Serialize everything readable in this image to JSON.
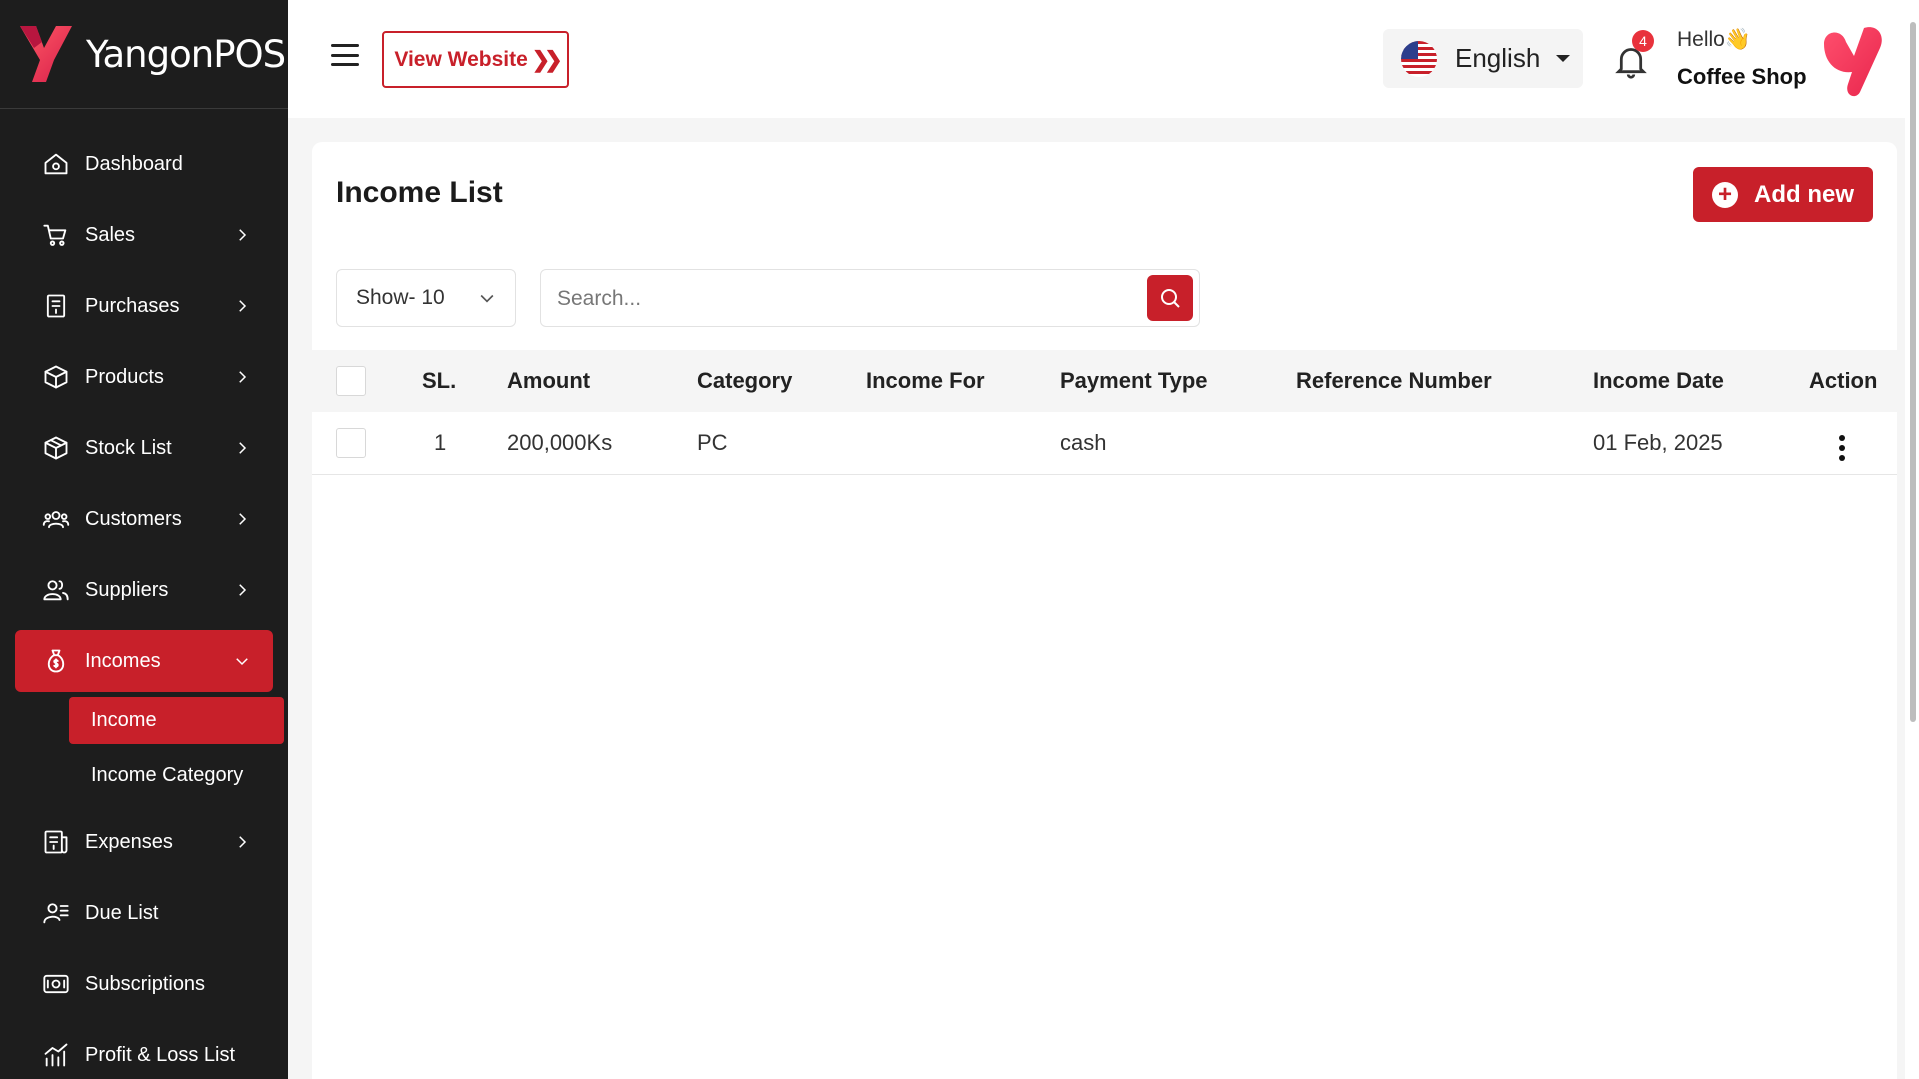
{
  "brand": {
    "name": "YangonPOS"
  },
  "sidebar": {
    "items": [
      {
        "label": "Dashboard",
        "icon": "home-icon",
        "has_children": false
      },
      {
        "label": "Sales",
        "icon": "cart-icon",
        "has_children": true
      },
      {
        "label": "Purchases",
        "icon": "receipt-icon",
        "has_children": true
      },
      {
        "label": "Products",
        "icon": "box-icon",
        "has_children": true
      },
      {
        "label": "Stock List",
        "icon": "package-icon",
        "has_children": true
      },
      {
        "label": "Customers",
        "icon": "users-icon",
        "has_children": true
      },
      {
        "label": "Suppliers",
        "icon": "user-group-icon",
        "has_children": true
      },
      {
        "label": "Incomes",
        "icon": "money-bag-icon",
        "has_children": true,
        "active": true
      },
      {
        "label": "Expenses",
        "icon": "invoice-icon",
        "has_children": true
      },
      {
        "label": "Due List",
        "icon": "user-list-icon",
        "has_children": false
      },
      {
        "label": "Subscriptions",
        "icon": "subscription-icon",
        "has_children": false
      },
      {
        "label": "Profit & Loss List",
        "icon": "chart-icon",
        "has_children": false
      }
    ],
    "incomes_sub": [
      {
        "label": "Income",
        "active": true
      },
      {
        "label": "Income Category",
        "active": false
      }
    ]
  },
  "header": {
    "view_website": "View Website",
    "language": "English",
    "notification_count": "4",
    "greeting": "Hello👋",
    "shop_name": "Coffee Shop"
  },
  "main": {
    "title": "Income List",
    "add_new": "Add new",
    "show_select": "Show- 10",
    "search_placeholder": "Search...",
    "columns": [
      "SL.",
      "Amount",
      "Category",
      "Income For",
      "Payment Type",
      "Reference Number",
      "Income Date",
      "Action"
    ],
    "rows": [
      {
        "sl": "1",
        "amount": "200,000Ks",
        "category": "PC",
        "income_for": "",
        "payment_type": "cash",
        "reference_number": "",
        "income_date": "01 Feb, 2025"
      }
    ]
  },
  "colors": {
    "accent": "#c8202a",
    "sidebar_bg": "#1d1d1d",
    "page_bg": "#f5f5f5"
  }
}
